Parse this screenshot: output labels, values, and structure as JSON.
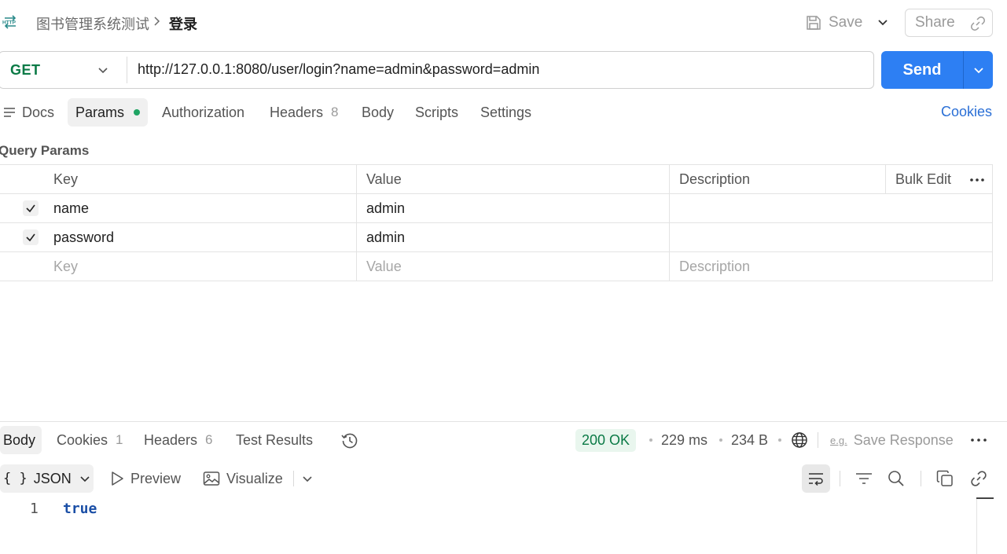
{
  "breadcrumb": {
    "icon_text": "HTTP",
    "parent": "图书管理系统测试",
    "current": "登录"
  },
  "toolbar": {
    "save_label": "Save",
    "share_label": "Share"
  },
  "request": {
    "method": "GET",
    "url": "http://127.0.0.1:8080/user/login?name=admin&password=admin",
    "send_label": "Send"
  },
  "request_tabs": {
    "docs": "Docs",
    "params": "Params",
    "authorization": "Authorization",
    "headers": "Headers",
    "headers_count": "8",
    "body": "Body",
    "scripts": "Scripts",
    "settings": "Settings",
    "cookies": "Cookies"
  },
  "params": {
    "title": "Query Params",
    "columns": {
      "key": "Key",
      "value": "Value",
      "description": "Description"
    },
    "bulk_edit": "Bulk Edit",
    "rows": [
      {
        "key": "name",
        "value": "admin",
        "description": "",
        "checked": true
      },
      {
        "key": "password",
        "value": "admin",
        "description": "",
        "checked": true
      }
    ],
    "placeholders": {
      "key": "Key",
      "value": "Value",
      "description": "Description"
    }
  },
  "response_tabs": {
    "body": "Body",
    "cookies": "Cookies",
    "cookies_count": "1",
    "headers": "Headers",
    "headers_count": "6",
    "test_results": "Test Results"
  },
  "response_meta": {
    "status": "200 OK",
    "time": "229 ms",
    "size": "234 B",
    "save_icon_text": "e.g.",
    "save_response": "Save Response"
  },
  "response_tools": {
    "format": "JSON",
    "preview": "Preview",
    "visualize": "Visualize"
  },
  "response_body": {
    "line_number": "1",
    "value": "true"
  },
  "colors": {
    "accent": "#2d7ff3",
    "method_green": "#0b7a46",
    "status_bg": "#e9f6ee"
  }
}
